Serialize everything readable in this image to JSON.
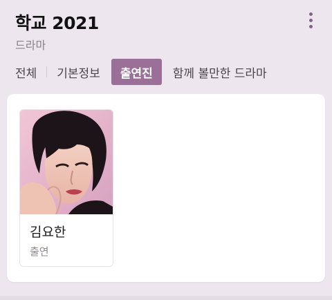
{
  "header": {
    "title": "학교 2021",
    "subtitle": "드라마"
  },
  "tabs": [
    {
      "label": "전체",
      "active": false
    },
    {
      "label": "기본정보",
      "active": false
    },
    {
      "label": "출연진",
      "active": true
    },
    {
      "label": "함께 볼만한 드라마",
      "active": false
    }
  ],
  "cast": [
    {
      "name": "김요한",
      "role": "출연"
    }
  ],
  "colors": {
    "accent": "#9a6f98",
    "background": "#ede6ee",
    "menu_dots": "#86628a"
  }
}
